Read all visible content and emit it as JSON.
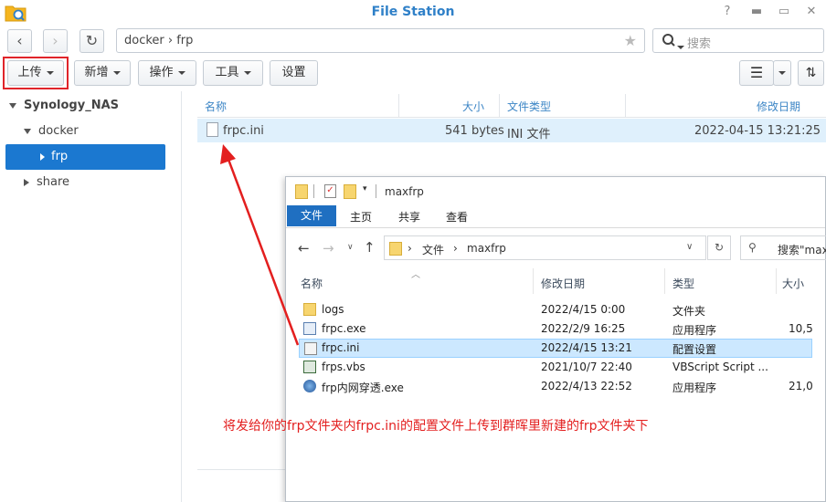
{
  "window": {
    "title": "File Station"
  },
  "toolbar": {
    "path": "docker  ›  frp",
    "search_placeholder": "搜索",
    "upload": "上传",
    "create": "新增",
    "action": "操作",
    "tools": "工具",
    "settings": "设置"
  },
  "sidebar": {
    "root": "Synology_NAS",
    "items": [
      "docker",
      "frp",
      "share"
    ]
  },
  "list": {
    "columns": [
      "名称",
      "大小",
      "文件类型",
      "修改日期"
    ],
    "rows": [
      {
        "name": "frpc.ini",
        "size": "541 bytes",
        "type": "INI 文件",
        "date": "2022-04-15 13:21:25"
      }
    ]
  },
  "explorer": {
    "title": "maxfrp",
    "tabs": [
      "文件",
      "主页",
      "共享",
      "查看"
    ],
    "breadcrumb": [
      "文件",
      "maxfrp"
    ],
    "search_placeholder": "搜索\"maxfrp\"",
    "columns": [
      "名称",
      "修改日期",
      "类型",
      "大小"
    ],
    "rows": [
      {
        "name": "logs",
        "date": "2022/4/15 0:00",
        "type": "文件夹",
        "size": ""
      },
      {
        "name": "frpc.exe",
        "date": "2022/2/9 16:25",
        "type": "应用程序",
        "size": "10,5"
      },
      {
        "name": "frpc.ini",
        "date": "2022/4/15 13:21",
        "type": "配置设置",
        "size": ""
      },
      {
        "name": "frps.vbs",
        "date": "2021/10/7 22:40",
        "type": "VBScript Script ...",
        "size": ""
      },
      {
        "name": "frp内网穿透.exe",
        "date": "2022/4/13 22:52",
        "type": "应用程序",
        "size": "21,0"
      }
    ]
  },
  "annotation": "将发给你的frp文件夹内frpc.ini的配置文件上传到群晖里新建的frp文件夹下",
  "colors": {
    "accent": "#1b78d0",
    "annotation": "#e31f1f",
    "title": "#2f80c8"
  }
}
